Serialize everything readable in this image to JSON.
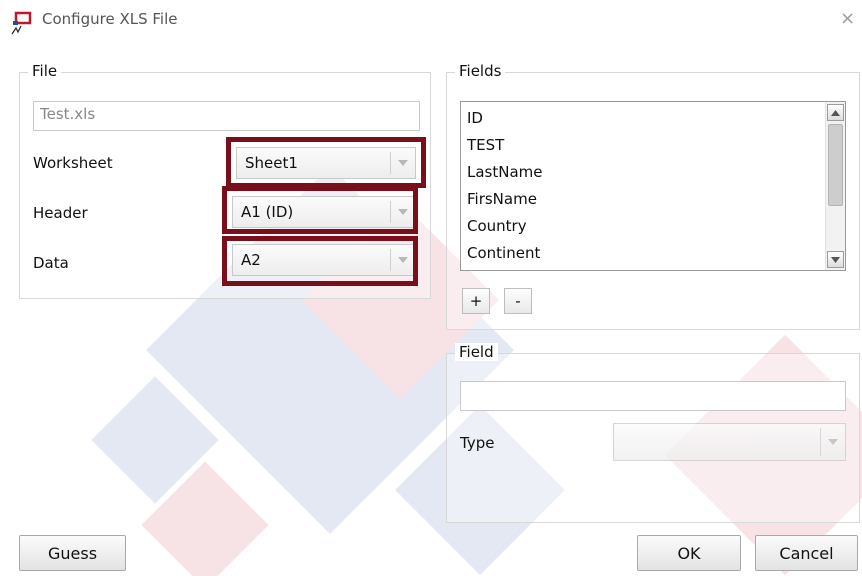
{
  "window": {
    "title": "Configure XLS File",
    "close_glyph": "×",
    "app_icon": "xls-config-icon"
  },
  "file_group": {
    "legend": "File",
    "file_name": "Test.xls",
    "worksheet": {
      "label": "Worksheet",
      "value": "Sheet1"
    },
    "header": {
      "label": "Header",
      "value": "A1 (ID)"
    },
    "data": {
      "label": "Data",
      "value": "A2"
    }
  },
  "fields_group": {
    "legend": "Fields",
    "items": [
      "ID",
      "TEST",
      "LastName",
      "FirsName",
      "Country",
      "Continent"
    ],
    "add_label": "+",
    "remove_label": "-"
  },
  "field_group": {
    "legend": "Field",
    "name_value": "",
    "type_label": "Type",
    "type_value": ""
  },
  "buttons": {
    "guess": "Guess",
    "ok": "OK",
    "cancel": "Cancel"
  },
  "colors": {
    "highlight": "#7a0f1c",
    "watermark_blue": "#dfe4f0",
    "watermark_red": "#f6dfe2"
  }
}
